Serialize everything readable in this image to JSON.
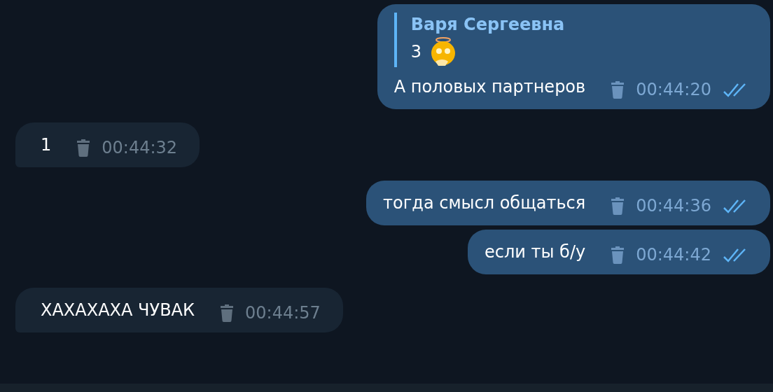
{
  "messages": [
    {
      "outgoing": true,
      "reply": {
        "author": "Варя Сергеевна",
        "text": "3",
        "emoji": true
      },
      "text": "А половых партнеров",
      "time": "00:44:20",
      "read": true
    },
    {
      "outgoing": false,
      "text": "1",
      "time": "00:44:32"
    },
    {
      "outgoing": true,
      "text": "тогда смысл общаться",
      "time": "00:44:36",
      "read": true
    },
    {
      "outgoing": true,
      "text": "если ты б/у",
      "time": "00:44:42",
      "read": true
    },
    {
      "outgoing": false,
      "text": "ХАХАХАХА ЧУВАК",
      "time": "00:44:57"
    }
  ]
}
